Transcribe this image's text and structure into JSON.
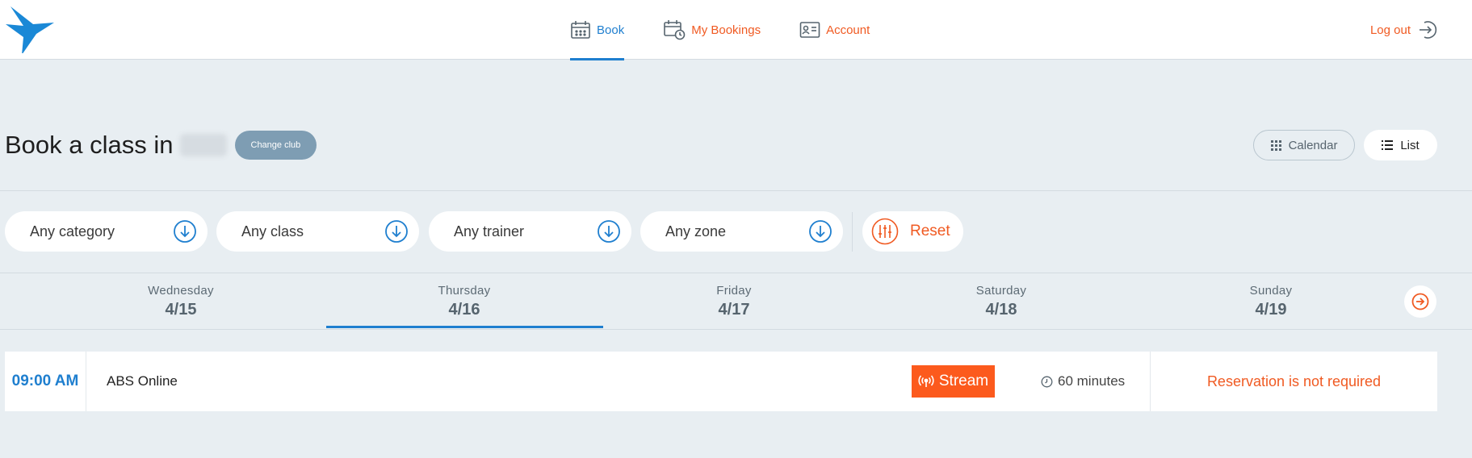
{
  "header": {
    "nav": [
      {
        "label": "Book",
        "icon": "calendar-icon",
        "active": true
      },
      {
        "label": "My Bookings",
        "icon": "calendar-clock-icon",
        "active": false
      },
      {
        "label": "Account",
        "icon": "id-card-icon",
        "active": false
      }
    ],
    "logout_label": "Log out"
  },
  "title": {
    "text": "Book a class in",
    "change_club_label": "Change club"
  },
  "view_toggle": {
    "calendar_label": "Calendar",
    "list_label": "List",
    "selected": "List"
  },
  "filters": [
    {
      "label": "Any category"
    },
    {
      "label": "Any class"
    },
    {
      "label": "Any trainer"
    },
    {
      "label": "Any zone"
    }
  ],
  "reset_label": "Reset",
  "days": [
    {
      "name": "Wednesday",
      "date": "4/15"
    },
    {
      "name": "Thursday",
      "date": "4/16",
      "selected": true
    },
    {
      "name": "Friday",
      "date": "4/17"
    },
    {
      "name": "Saturday",
      "date": "4/18"
    },
    {
      "name": "Sunday",
      "date": "4/19"
    }
  ],
  "classes": [
    {
      "time": "09:00 AM",
      "name": "ABS Online",
      "badge": "Stream",
      "duration": "60 minutes",
      "reservation": "Reservation is not required"
    }
  ],
  "colors": {
    "primary_blue": "#1f7fcf",
    "accent_orange": "#f05a22",
    "stream_orange": "#fc5a1d",
    "background": "#e8eef2",
    "change_club_bg": "#7e9db3"
  }
}
